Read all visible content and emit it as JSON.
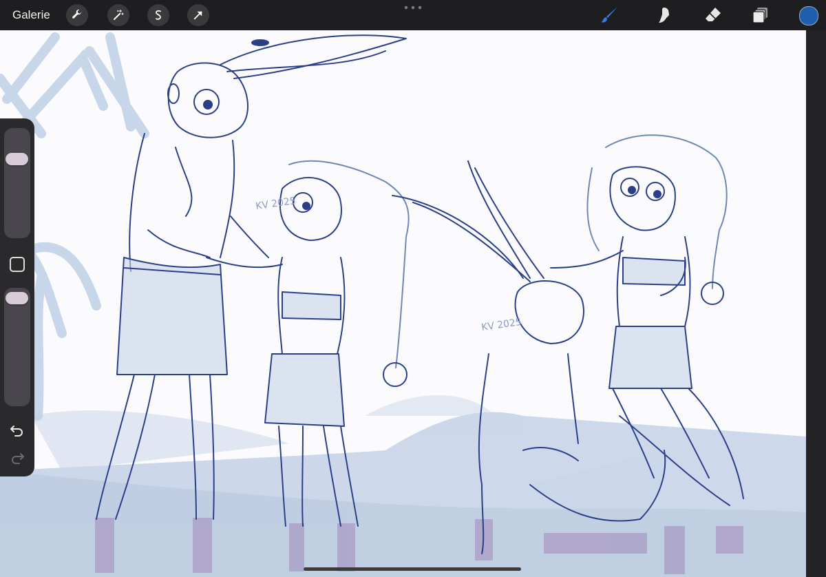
{
  "toolbar": {
    "gallery_label": "Galerie",
    "left_tools": [
      "wrench-icon",
      "magic-wand-icon",
      "selection-s-icon",
      "move-arrow-icon"
    ],
    "right_tools": [
      "brush-icon",
      "smudge-icon",
      "eraser-icon",
      "layers-icon"
    ],
    "active_tool": "brush-icon",
    "current_color": "#1f5fae",
    "accent_color": "#2a7fe0"
  },
  "sidebar": {
    "brush_size_level": 0.0,
    "opacity_level": 0.0,
    "modify_button": "square-icon",
    "undo_icon": "undo-icon",
    "redo_icon": "redo-icon"
  },
  "canvas": {
    "watermarks": [
      "KV 2025",
      "KV 2025"
    ],
    "line_color": "#2b3f88",
    "fill_color": "#b9c6dc",
    "shadow_color": "#a99bc6",
    "background": "#fbfbfe"
  }
}
